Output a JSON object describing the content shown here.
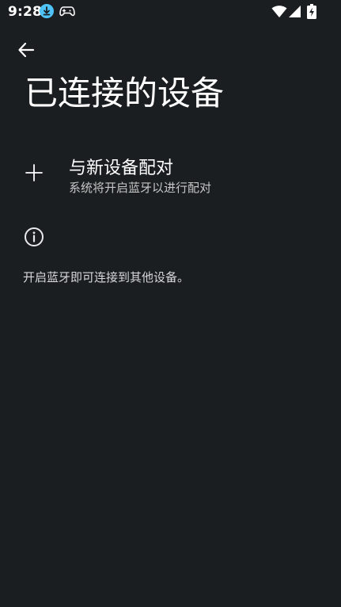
{
  "status_bar": {
    "time": "9:28",
    "icons": [
      "download-icon",
      "gamepad-icon",
      "wifi-icon",
      "signal-icon",
      "battery-charging-icon"
    ]
  },
  "toolbar": {
    "back_icon": "arrow-back-icon"
  },
  "page": {
    "title": "已连接的设备"
  },
  "pair_new_device": {
    "icon": "plus-icon",
    "title": "与新设备配对",
    "subtitle": "系统将开启蓝牙以进行配对"
  },
  "info": {
    "icon": "info-icon",
    "text": "开启蓝牙即可连接到其他设备。"
  },
  "colors": {
    "background": "#1b1e21",
    "text_primary": "#ffffff",
    "text_secondary": "#c4c7c5",
    "download_badge": "#4fc3f7"
  }
}
